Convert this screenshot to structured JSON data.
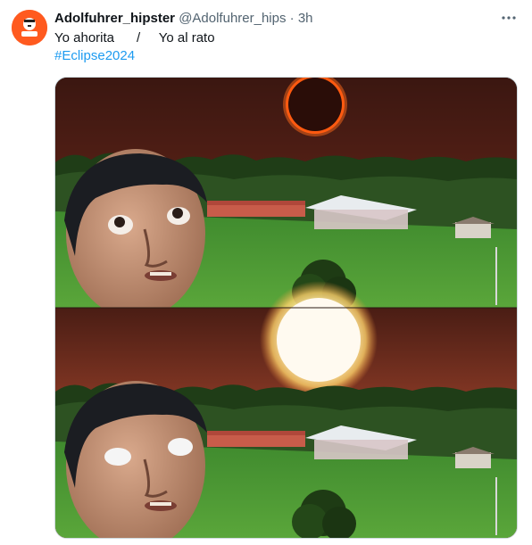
{
  "tweet": {
    "author_name": "Adolfuhrer_hipster",
    "handle": "@Adolfuhrer_hips",
    "separator": "·",
    "time": "3h",
    "text": "Yo ahorita      /     Yo al rato",
    "hashtag": "#Eclipse2024",
    "more_icon": "more-horizontal-icon"
  },
  "media": {
    "panels": [
      {
        "sky": "eclipse-darkened-sun",
        "face": "boy-looking-up"
      },
      {
        "sky": "bright-sun",
        "face": "boy-with-blank-white-eyes"
      }
    ]
  },
  "colors": {
    "accent_link": "#1d9bf0",
    "avatar_bg": "#ff5a1f",
    "secondary_text": "#536471",
    "border": "#cfd9de"
  }
}
